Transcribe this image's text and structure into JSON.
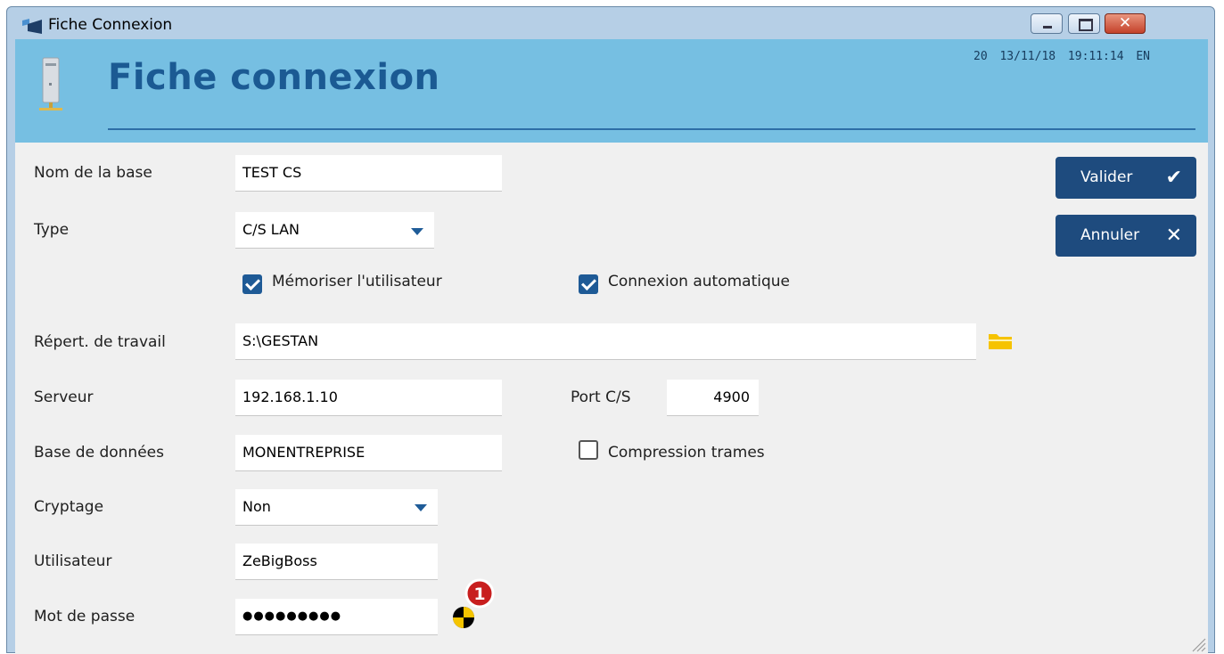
{
  "window": {
    "title": "Fiche Connexion",
    "close_glyph": "✕"
  },
  "header": {
    "title": "Fiche connexion",
    "status": "20 13/11/18 19:11:14 EN"
  },
  "form": {
    "nom_base": {
      "label": "Nom de la base",
      "value": "TEST CS"
    },
    "type": {
      "label": "Type",
      "value": "C/S LAN"
    },
    "memoriser": {
      "label": "Mémoriser l'utilisateur",
      "checked": true
    },
    "connexion_auto": {
      "label": "Connexion automatique",
      "checked": true
    },
    "repertoire": {
      "label": "Répert. de travail",
      "value": "S:\\GESTAN"
    },
    "serveur": {
      "label": "Serveur",
      "value": "192.168.1.10"
    },
    "port": {
      "label": "Port C/S",
      "value": "4900"
    },
    "base_donnees": {
      "label": "Base de données",
      "value": "MONENTREPRISE"
    },
    "compression": {
      "label": "Compression trames",
      "checked": false
    },
    "cryptage": {
      "label": "Cryptage",
      "value": "Non"
    },
    "utilisateur": {
      "label": "Utilisateur",
      "value": "ZeBigBoss"
    },
    "mot_de_passe": {
      "label": "Mot de passe",
      "value": "●●●●●●●●●"
    }
  },
  "buttons": {
    "valider": {
      "label": "Valider",
      "glyph": "✔"
    },
    "annuler": {
      "label": "Annuler",
      "glyph": "✕"
    }
  },
  "password_badge": "1",
  "colors": {
    "header_bg": "#76bfe2",
    "title_color": "#1b5a93",
    "button_bg": "#1e4b7e",
    "checkbox_on": "#1e5a96",
    "badge_red": "#c81e1e"
  }
}
